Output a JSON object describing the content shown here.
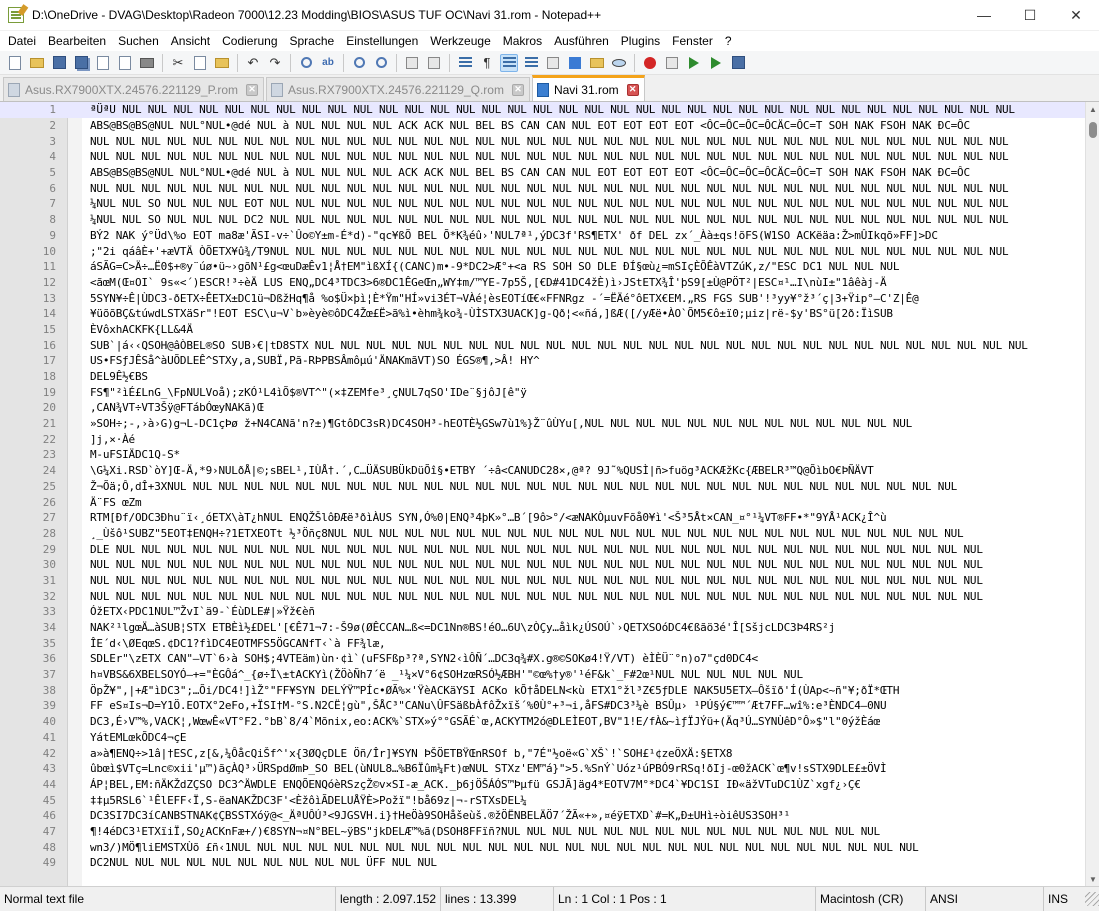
{
  "window": {
    "title": "D:\\OneDrive - DVAG\\Desktop\\Radeon 7000\\12.23 Modding\\BIOS\\ASUS TUF OC\\Navi 31.rom - Notepad++",
    "minimize_glyph": "—",
    "maximize_glyph": "☐",
    "close_glyph": "✕"
  },
  "menu": [
    {
      "label": "Datei"
    },
    {
      "label": "Bearbeiten"
    },
    {
      "label": "Suchen"
    },
    {
      "label": "Ansicht"
    },
    {
      "label": "Codierung"
    },
    {
      "label": "Sprache"
    },
    {
      "label": "Einstellungen"
    },
    {
      "label": "Werkzeuge"
    },
    {
      "label": "Makros"
    },
    {
      "label": "Ausführen"
    },
    {
      "label": "Plugins"
    },
    {
      "label": "Fenster"
    },
    {
      "label": "?"
    }
  ],
  "toolbar": [
    {
      "icon": "new-file-icon",
      "cls": "ic-doc"
    },
    {
      "icon": "open-folder-icon",
      "cls": "ic-folder"
    },
    {
      "icon": "save-icon",
      "cls": "ic-save"
    },
    {
      "icon": "save-all-icon",
      "cls": "ic-saveall"
    },
    {
      "icon": "close-file-icon",
      "cls": "ic-close"
    },
    {
      "icon": "close-all-icon",
      "cls": "ic-close"
    },
    {
      "icon": "print-icon",
      "cls": "ic-print"
    },
    {
      "sep": true
    },
    {
      "icon": "cut-icon",
      "cls": "ic-cut",
      "glyph": "✂"
    },
    {
      "icon": "copy-icon",
      "cls": "ic-doc"
    },
    {
      "icon": "paste-icon",
      "cls": "ic-folder"
    },
    {
      "sep": true
    },
    {
      "icon": "undo-icon",
      "cls": "ic-cut",
      "glyph": "↶"
    },
    {
      "icon": "redo-icon",
      "cls": "ic-cut",
      "glyph": "↷"
    },
    {
      "sep": true
    },
    {
      "icon": "find-icon",
      "cls": "ic-mag"
    },
    {
      "icon": "replace-icon",
      "cls": "ic-ab",
      "glyph": "ab"
    },
    {
      "sep": true
    },
    {
      "icon": "zoom-in-icon",
      "cls": "ic-mag"
    },
    {
      "icon": "zoom-out-icon",
      "cls": "ic-mag"
    },
    {
      "sep": true
    },
    {
      "icon": "sync-vertical-icon",
      "cls": "ic-square"
    },
    {
      "icon": "sync-horizontal-icon",
      "cls": "ic-square"
    },
    {
      "sep": true
    },
    {
      "icon": "word-wrap-icon",
      "cls": "ic-lines"
    },
    {
      "icon": "show-all-chars-icon",
      "cls": "ic-cut",
      "glyph": "¶"
    },
    {
      "icon": "indent-guide-icon",
      "cls": "ic-lines",
      "active": true
    },
    {
      "icon": "user-language-icon",
      "cls": "ic-lines"
    },
    {
      "icon": "doc-map-icon",
      "cls": "ic-square"
    },
    {
      "icon": "function-list-icon",
      "cls": "ic-blue"
    },
    {
      "icon": "folder-workspace-icon",
      "cls": "ic-folder"
    },
    {
      "icon": "monitoring-icon",
      "cls": "ic-eye"
    },
    {
      "sep": true
    },
    {
      "icon": "record-macro-icon",
      "cls": "ic-red"
    },
    {
      "icon": "stop-macro-icon",
      "cls": "ic-square"
    },
    {
      "icon": "play-macro-icon",
      "cls": "ic-play"
    },
    {
      "icon": "run-macro-multiple-icon",
      "cls": "ic-play"
    },
    {
      "icon": "save-macro-icon",
      "cls": "ic-save"
    }
  ],
  "tabs": [
    {
      "label": "Asus.RX7900XTX.24576.221129_P.rom",
      "active": false
    },
    {
      "label": "Asus.RX7900XTX.24576.221129_Q.rom",
      "active": false
    },
    {
      "label": "Navi 31.rom",
      "active": true
    }
  ],
  "tab_close_glyph": "✕",
  "editor": {
    "current_line": 1,
    "lines": [
      {
        "n": "1",
        "text": "ªÜªU NUL NUL NUL NUL NUL NUL NUL NUL NUL NUL NUL NUL NUL NUL NUL NUL NUL NUL NUL NUL NUL NUL NUL NUL NUL NUL NUL NUL NUL NUL NUL NUL NUL NUL NUL"
      },
      {
        "n": "2",
        "text": "ABS@BS@BS@NUL NUL°NUL•@dé NUL à NUL NUL NUL NUL ACK ACK NUL BEL BS CAN CAN NUL EOT EOT EOT EOT <ÔC=ÔC=ÔC=ÔCÄC=ÔC=T SOH NAK FSOH NAK ÐC=ÔC"
      },
      {
        "n": "3",
        "text": "NUL NUL NUL NUL NUL NUL NUL NUL NUL NUL NUL NUL NUL NUL NUL NUL NUL NUL NUL NUL NUL NUL NUL NUL NUL NUL NUL NUL NUL NUL NUL NUL NUL NUL NUL NUL"
      },
      {
        "n": "4",
        "text": "NUL NUL NUL NUL NUL NUL NUL NUL NUL NUL NUL NUL NUL NUL NUL NUL NUL NUL NUL NUL NUL NUL NUL NUL NUL NUL NUL NUL NUL NUL NUL NUL NUL NUL NUL NUL"
      },
      {
        "n": "5",
        "text": "ABS@BS@BS@NUL NUL°NUL•@dé NUL à NUL NUL NUL NUL ACK ACK NUL BEL BS CAN CAN NUL EOT EOT EOT EOT <ÔC=ÔC=ÔC=ÔCÄC=ÔC=T SOH NAK FSOH NAK ÐC=ÔC"
      },
      {
        "n": "6",
        "text": "NUL NUL NUL NUL NUL NUL NUL NUL NUL NUL NUL NUL NUL NUL NUL NUL NUL NUL NUL NUL NUL NUL NUL NUL NUL NUL NUL NUL NUL NUL NUL NUL NUL NUL NUL NUL"
      },
      {
        "n": "7",
        "text": "¼NUL NUL SO NUL NUL NUL EOT NUL NUL NUL NUL NUL NUL NUL NUL NUL NUL NUL NUL NUL NUL NUL NUL NUL NUL NUL NUL NUL NUL NUL NUL NUL NUL NUL NUL NUL"
      },
      {
        "n": "8",
        "text": "¼NUL NUL SO NUL NUL NUL DC2 NUL NUL NUL NUL NUL NUL NUL NUL NUL NUL NUL NUL NUL NUL NUL NUL NUL NUL NUL NUL NUL NUL NUL NUL NUL NUL NUL NUL NUL"
      },
      {
        "n": "9",
        "text": "BÝ2 NAK ý°Üd\\%o EOT ma8æ'ÃSI-v÷`Ûo©Y±m-É*d)-\"qc¥ßÕ BEL Õ*K¾éû›'NUL7ª¹,ýDC3f'RS¶ETX' ðf DEL zx´_Àà±qs!õFS(W1SO ACKëäa:Ž>mÛIkqõ»FF]>DC"
      },
      {
        "n": "10",
        "text": ";\"2i qáâÈ+'+æVTÄ ÒÕETX¥û¾/T9NUL NUL NUL NUL NUL NUL NUL NUL NUL NUL NUL NUL NUL NUL NUL NUL NUL NUL NUL NUL NUL NUL NUL NUL NUL NUL NUL NUL NUL"
      },
      {
        "n": "11",
        "text": "áSÃG=C>Ä÷…Ë0$+®y¨úø•ü~›gõN¹£g<œuDæÊv1¦Å†EM\"ìßXÍ{(CANC)m•-9*DC2>Æ°+<a RS SOH SO DLE ÐÍ§œù¿=mSIçÈÕÊàVTZúK,z/\"ESC DC1 NUL NUL NUL"
      },
      {
        "n": "12",
        "text": "<ãœM(Œ¤OI` 9s«<´)ESCR!³÷èÄ LUS ENQ„DC4³TDC3>6®DC1ÊGeŒn„WY‡m/™YE-7p5Š,[€D#41DC4žÈ)ì›JStETX¾Î'þS9[±Ù@PÖT²|ESC¤¹…I\\nùI±\"1âêàj-Ä"
      },
      {
        "n": "13",
        "text": "5SYN¥÷Ê|ÙDC3-ðETX÷ÊETX±DC1ü¬DßžHq¶å %o$Ü×þì¦È*Ÿm\"HÍ»vi3ÉT¬VÀé¦èsEOTíŒ€«FFNRgz -´=ËÄé°ôETX€EM.„RS FGS SUB'!³yy¥°ž³´ç|3+Ÿip°—C'Z|Ê@"
      },
      {
        "n": "14",
        "text": "¥üõõBÇ&túwdLSTXäSr\"!EOT ESC\\u¬V`b»èyè©ôDC4Žœ£Ë>ã%ì•èhm¾ko¾-ÙÌSTX3UACK]g-Qð¦<«ñá,]ßÆ([/yÆë•ÀO`ÕM5€ô±ï0;µiz|rë-$y'BS°ü[2ð:ÏìSUB"
      },
      {
        "n": "15",
        "text": "ÈVôxhACKFK{LL&4Ä"
      },
      {
        "n": "16",
        "text": "SUB`|á‹‹QSOH@âÒBEL®SO SUB›€|tD8STX NUL NUL NUL NUL NUL NUL NUL NUL NUL NUL NUL NUL NUL NUL NUL NUL NUL NUL NUL NUL NUL NUL NUL NUL NUL NUL NUL NUL"
      },
      {
        "n": "17",
        "text": "US•FSƒJÊSå^àUÕDLEÊ^STXy,a,SUBÏ,Pã-RÞPBSÂmôµú'ÄNAKmãVT)SO ÉGS®¶,>Â! HY^"
      },
      {
        "n": "18",
        "text": "DEL9Ê½€BS"
      },
      {
        "n": "19",
        "text": "FS¶\"²ìÉ£LnG_\\FpNULVoå);zKÓ¹L4ìÕ$®VT^\"(×‡ZEMfe³¸çNUL7qSO'IDe¨§jôJ[ê\"ÿ"
      },
      {
        "n": "20",
        "text": ",CAN¾VT÷VT3Šÿ@FTábÓœyNAKã)Œ"
      },
      {
        "n": "21",
        "text": "»SOH÷;-,›à›G)g¬L-DC1çÞø ž+N4CANã'n?±)¶GtôDC3sR)DC4SOH³-hEOTÈ½GSw7ù1%}Ž¨ûÙYu[,NUL NUL NUL NUL NUL NUL NUL NUL NUL NUL NUL NUL NUL"
      },
      {
        "n": "22",
        "text": "]j,×·Àé"
      },
      {
        "n": "23",
        "text": "M-uFSIÄDC1Q-S*"
      },
      {
        "n": "24",
        "text": "\\G¼Xi.RSD`òY]Œ-Ä,*9›NULðÅ|©;sBEL¹,IÙÅ†.´,C…ÜÄSUBÜkDüÕî§•ETBY ´÷â<CANUDC28×,@ª? 9J˜%QUSÌ|ñ>fuög³ACKÆžKc{ÆBELR³™Q@ÕìbO€ÞÑÄVT"
      },
      {
        "n": "25",
        "text": "Ž¬Õä;Ô,dÎ+3XNUL NUL NUL NUL NUL NUL NUL NUL NUL NUL NUL NUL NUL NUL NUL NUL NUL NUL NUL NUL NUL NUL NUL NUL NUL NUL NUL NUL NUL NUL NUL"
      },
      {
        "n": "26",
        "text": "Ä¨FS œZm"
      },
      {
        "n": "27",
        "text": "RTM[Ðf/ODC3Ðhu¨ï‹¸óETX\\àT¿hNUL ENQŽŠlôÐÆë³ðìÀUS SYN,Ó%0|ENQ³4þK»°…B´[9ô>°/<æNAKÒµuvFõå0¥ì'<Š³5Åt×CAN_¤°¹¼VT®FF•*\"9YÅ¹ACK¿Î^ù"
      },
      {
        "n": "28",
        "text": "¸_Ùšô¹SUBZ\"5EOT‡ENQH÷?1ETXEOTt ½³Öñç8NUL NUL NUL NUL NUL NUL NUL NUL NUL NUL NUL NUL NUL NUL NUL NUL NUL NUL NUL NUL NUL NUL NUL NUL NUL"
      },
      {
        "n": "29",
        "text": "DLE NUL NUL NUL NUL NUL NUL NUL NUL NUL NUL NUL NUL NUL NUL NUL NUL NUL NUL NUL NUL NUL NUL NUL NUL NUL NUL NUL NUL NUL NUL NUL NUL NUL NUL"
      },
      {
        "n": "30",
        "text": "NUL NUL NUL NUL NUL NUL NUL NUL NUL NUL NUL NUL NUL NUL NUL NUL NUL NUL NUL NUL NUL NUL NUL NUL NUL NUL NUL NUL NUL NUL NUL NUL NUL NUL NUL"
      },
      {
        "n": "31",
        "text": "NUL NUL NUL NUL NUL NUL NUL NUL NUL NUL NUL NUL NUL NUL NUL NUL NUL NUL NUL NUL NUL NUL NUL NUL NUL NUL NUL NUL NUL NUL NUL NUL NUL NUL NUL"
      },
      {
        "n": "32",
        "text": "NUL NUL NUL NUL NUL NUL NUL NUL NUL NUL NUL NUL NUL NUL NUL NUL NUL NUL NUL NUL NUL NUL NUL NUL NUL NUL NUL NUL NUL NUL NUL NUL NUL NUL NUL"
      },
      {
        "n": "33",
        "text": "ÓžETX‹PDC1NUL™ŽvI`ä9-`ÉùDLE#|»Ÿž€èñ"
      },
      {
        "n": "34",
        "text": "NAK²¹lgœÄ…àSUB¦STX ETBÈì½£DEL'[€Ê71¬7:-Š9ø(ØÊCCAN…ß<=DC1Nn®BS!éO…6U\\zÒÇy…åìk¿ÚSOÚ`›QETXSOóDC4€ßãö3é'Î[SšjcLDC3Þ4RS²j"
      },
      {
        "n": "35",
        "text": "ÎE´d‹\\ØEqœS.¢DC1?fìDC4EOTMFS5ÖGCANfT‹`à FF¾læ,"
      },
      {
        "n": "36",
        "text": "SDLEr\"\\zETX CAN\"—VT`6›à SOH$;4VTEäm)ùn·¢ì`(uFSFßp³?ª,SYN2‹ìÔÑ´…DC3q¾#X.g®©SOKø4!Ÿ/VT) èÌÈÜ¨°n)o7\"çd0DC4<"
      },
      {
        "n": "37",
        "text": "h¤VBS&6XBELSOYÓ—+=\"ÈGÔá^_{ø÷Ï\\±tACKYì(ŽÖòÑh7´ë _¹¼×V°6¢SOHzœRSÓ½ÆBH'\"©œ%†y®'¹éF&k`_F#2œ¹NUL NUL NUL NUL NUL NUL"
      },
      {
        "n": "38",
        "text": "ÖpŽ¥\",|+Æ\"ìDC3\";…Õi/DC4!]ìŽ°\"FF¥SYN DELÝŸ™PÍc•ØÃ%×'ŸèACKäYSI ACKo kÕ†åDELN<kù ETX1°žl³Z€5ƒDLE NAK5U5ETX—Ôšïð'Í(ÙAp<~ñ\"¥;ðÏ*ŒTH"
      },
      {
        "n": "39",
        "text": "FF eS¤Is¬D=Y1Ö.EOTX°2eFo,+ÏSI†M-°S.N2CË¦gù\",ŠÅC³\"CANu\\ÛFSäßbÀfôŽxïš´%0Ù°+³¬i,åFS#DC3³¼è BSÛµ› ¹PÚ§ý€™™´Æt7FF…wî%:e³ÈNDC4—0NU"
      },
      {
        "n": "40",
        "text": "DC3,É›V™%,VACK¦,WœwÊ«VT°F2.°bB`8/4`Mõnix,eo:ACK%`STX»ý°°GSÃÉ`œ,ACKYTM2ó@DLEÌEOT,BV\"1!E/fÀ&~ìƒÏJÝü+(Äq³Ú…SYNÙêD°Ô»$\"l\"0ýžÈáœ"
      },
      {
        "n": "41",
        "text": "YátEMLœkÕDC4¬çE"
      },
      {
        "n": "42",
        "text": "a»à¶ENQ÷>1â|†ESC,z[&,¼ÔåcQiŠf^'x{3ØQçDLE Öñ/Îr]¥SYN ÞŠÖETBŸŒnRSOf b,\"7É\"½oë«G`XŠ`!`SOH£¹¢zeÖXÄ:§ETX8"
      },
      {
        "n": "43",
        "text": "ûbœì$VTç=Lnc©xii'µ™)ãçÀQ³›ÜRSpdØmÞ_SO BEL(ùNUL8…%B6Ïûm¼Ft)œNUL STXz'EM™á}\">5.%SnÝ`Uóz¹úPBÓ9rRSq!ðIj-œ0žACK`œ¶v!sSTX9DLE£±ÖVÌ"
      },
      {
        "n": "44",
        "text": "ÁP¦BEL,EM:ñÄKŽdZÇSO DC3^ÄWDLE ENQÕENQóèRSzçŽ©v×SI-æ_ACK._þ6jÖŠÁÓS™Þµfü GSJÃ]äg4*EOTV7M°*DC4`¥DC1SI IÐ«äžVTuDC1ÙZ`xgf¿›Ç€"
      },
      {
        "n": "45",
        "text": "‡‡µ5RSL6`¹ÊlEFF‹Ï,S-ëaNAKŽDC3F'<ÈžôìÃDELUÅŸÈ>Požï\"!bå69z|¬-rSTXsDEL¼"
      },
      {
        "n": "46",
        "text": "DC3SI7DC3íCANBSTNAK¢ÇBSSTXóÿ@<_ÄªUÔÚ³<9JGSVH.i}†HeÖà9SOHåšeùš.®žÖËNBELÄÖ7´ŽÃ«+»,¤éÿETXD`#=K„Ð±UHì÷òiêUS3SOH³¹"
      },
      {
        "n": "47",
        "text": "¶!4éDC3¹ETXïiÏ,SO¿ACKnFæ+/)€8SYN¬¤N°BEL~ÿBS\"jkDELÆ™%ã(DSOH8FFïñ?NUL NUL NUL NUL NUL NUL NUL NUL NUL NUL NUL NUL NUL NUL NUL"
      },
      {
        "n": "48",
        "text": "wn3/)MÖ¶liEMSTXÙõ £ñ‹1NUL NUL NUL NUL NUL NUL NUL NUL NUL NUL NUL NUL NUL NUL NUL NUL NUL NUL NUL NUL NUL NUL NUL NUL NUL NUL NUL"
      },
      {
        "n": "49",
        "text": "DC2NUL NUL NUL NUL NUL NUL NUL NUL NUL NUL ÜFF NUL NUL"
      }
    ]
  },
  "scrollbar": {
    "up_glyph": "▲",
    "down_glyph": "▼"
  },
  "status": {
    "filetype": "Normal text file",
    "length": "length : 2.097.152",
    "lines": "lines : 13.399",
    "position": "Ln : 1   Col : 1   Pos : 1",
    "eol": "Macintosh (CR)",
    "encoding": "ANSI",
    "mode": "INS"
  }
}
